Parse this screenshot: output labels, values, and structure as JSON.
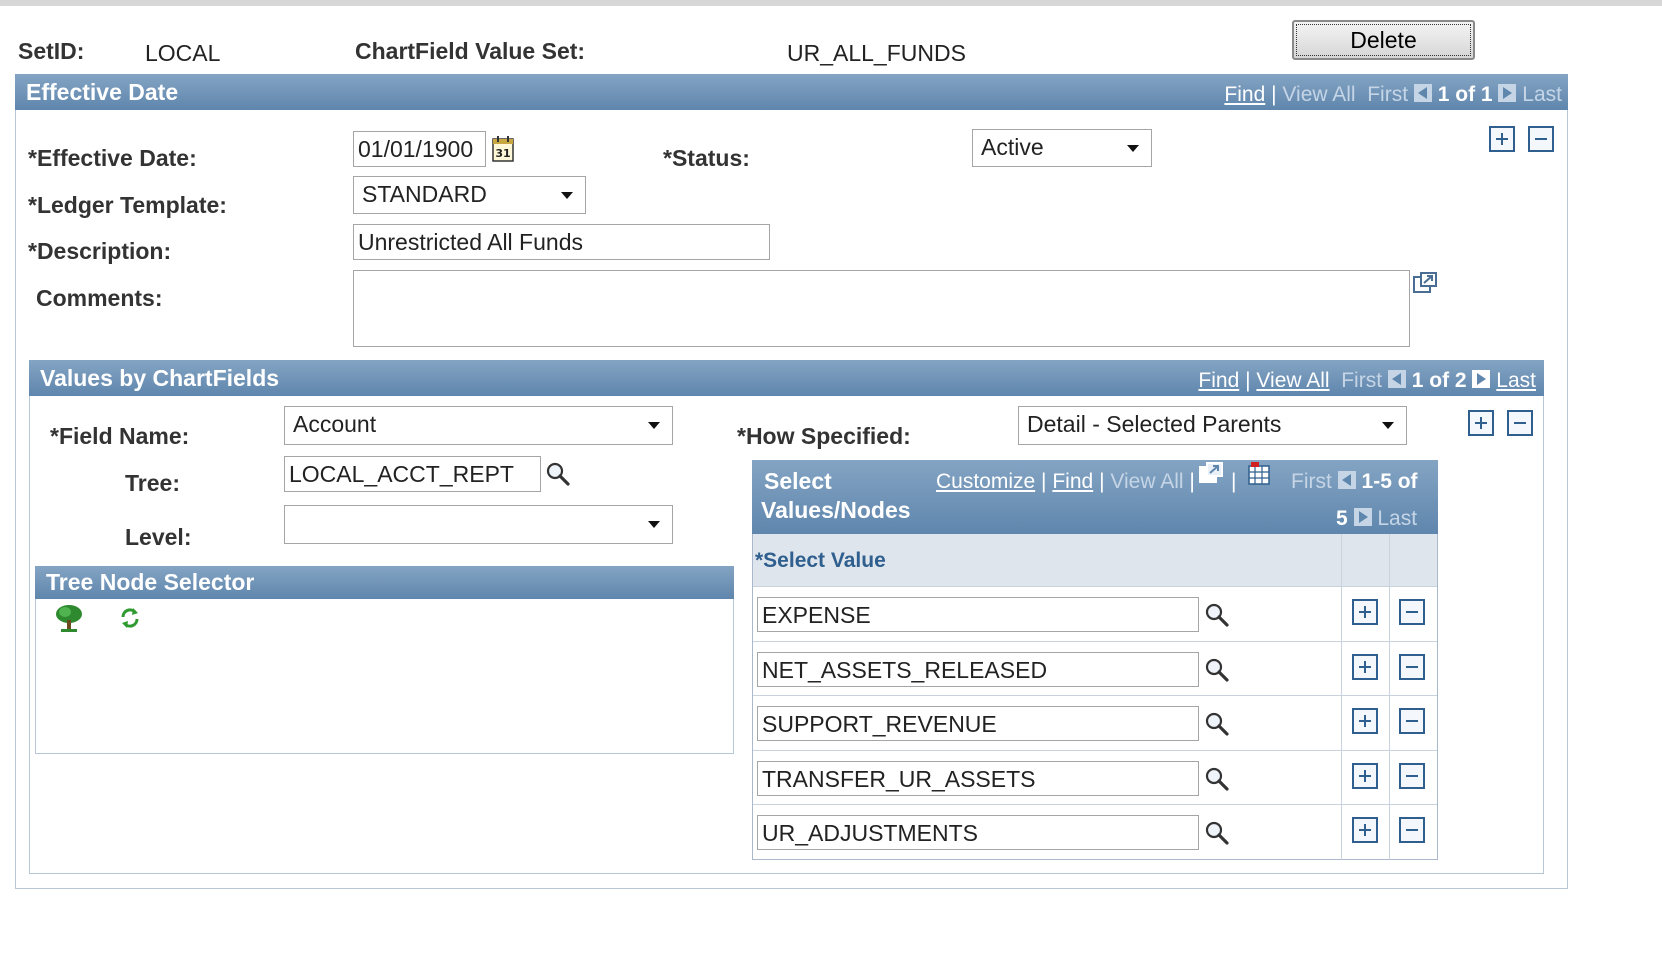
{
  "header": {
    "setid_label": "SetID:",
    "setid_value": "LOCAL",
    "cfvs_label": "ChartField Value Set:",
    "cfvs_value": "UR_ALL_FUNDS",
    "delete_label": "Delete"
  },
  "effective_panel": {
    "title": "Effective Date",
    "nav": {
      "find": "Find",
      "sep": "|",
      "view_all": "View All",
      "first": "First",
      "count": "1 of 1",
      "last": "Last"
    },
    "effective_date_label": "*Effective Date:",
    "effective_date_value": "01/01/1900",
    "calendar_icon_text": "31",
    "status_label": "*Status:",
    "status_value": "Active",
    "ledger_label": "*Ledger Template:",
    "ledger_value": "STANDARD",
    "description_label": "*Description:",
    "description_value": "Unrestricted All Funds",
    "comments_label": "Comments:",
    "comments_value": ""
  },
  "values_panel": {
    "title": "Values by ChartFields",
    "nav": {
      "find": "Find",
      "sep": "|",
      "view_all": "View All",
      "first": "First",
      "count": "1 of 2",
      "last": "Last"
    },
    "field_name_label": "*Field Name:",
    "field_name_value": "Account",
    "tree_label": "Tree:",
    "tree_value": "LOCAL_ACCT_REPT",
    "level_label": "Level:",
    "level_value": "",
    "how_label": "*How Specified:",
    "how_value": "Detail - Selected Parents"
  },
  "tree_node_selector": {
    "title": "Tree Node Selector"
  },
  "select_grid": {
    "title_line1": "Select",
    "title_line2": "Values/Nodes",
    "customize": "Customize",
    "find": "Find",
    "view_all": "View All",
    "sep": "|",
    "first": "First",
    "count_a": "1-5 of",
    "count_b": "5",
    "last": "Last",
    "column_header": "*Select Value",
    "rows": [
      "EXPENSE",
      "NET_ASSETS_RELEASED",
      "SUPPORT_REVENUE",
      "TRANSFER_UR_ASSETS",
      "UR_ADJUSTMENTS"
    ]
  },
  "icons": {
    "calendar": "calendar-icon",
    "lookup": "magnifier-icon",
    "expand": "expand-window-icon",
    "tree": "tree-icon",
    "refresh": "refresh-icon",
    "grid_download": "grid-icon",
    "add": "plus-icon",
    "remove": "minus-icon"
  },
  "colors": {
    "header_blue": "#6b8fb4",
    "border_blue": "#b8c7d6",
    "button_blue": "#2f5f8e"
  }
}
